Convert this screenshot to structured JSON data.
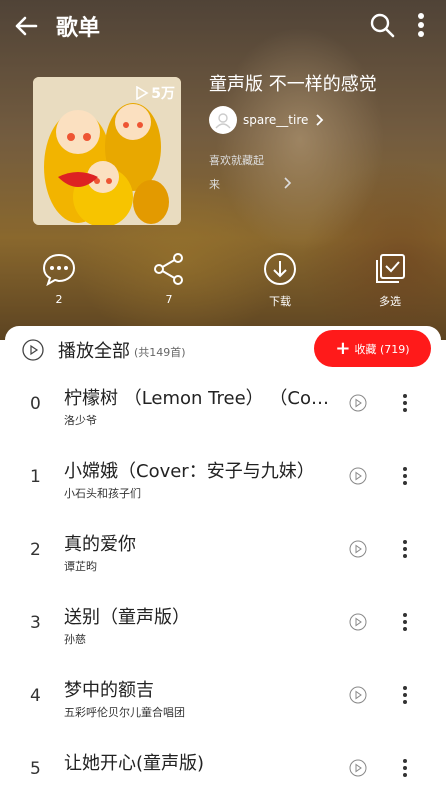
{
  "header": {
    "title": "歌单"
  },
  "playlist": {
    "name": "童声版 不一样的感觉",
    "play_count": "5万",
    "creator": "spare__tire",
    "desc_line1": "喜欢就藏起",
    "desc_line2": "来"
  },
  "actions": [
    {
      "label": "2",
      "icon": "comment-icon"
    },
    {
      "label": "7",
      "icon": "share-icon"
    },
    {
      "label": "下载",
      "icon": "download-icon"
    },
    {
      "label": "多选",
      "icon": "multi-select-icon"
    }
  ],
  "list": {
    "play_all_label": "播放全部",
    "count_label": "(共149首)",
    "collect_label": "收藏 (719)",
    "songs": [
      {
        "index": "0",
        "title": "柠檬树 （Lemon Tree） （Cover：Fool's Garden）",
        "artist": "洛少爷"
      },
      {
        "index": "1",
        "title": "小嫦娥（Cover：安子与九妹）",
        "artist": "小石头和孩子们"
      },
      {
        "index": "2",
        "title": "真的爱你",
        "artist": "谭芷昀"
      },
      {
        "index": "3",
        "title": "送别（童声版）",
        "artist": "孙慈"
      },
      {
        "index": "4",
        "title": "梦中的额吉",
        "artist": "五彩呼伦贝尔儿童合唱团"
      },
      {
        "index": "5",
        "title": "让她开心(童声版)",
        "artist": ""
      }
    ]
  },
  "colors": {
    "accent": "#ff1a1a"
  }
}
